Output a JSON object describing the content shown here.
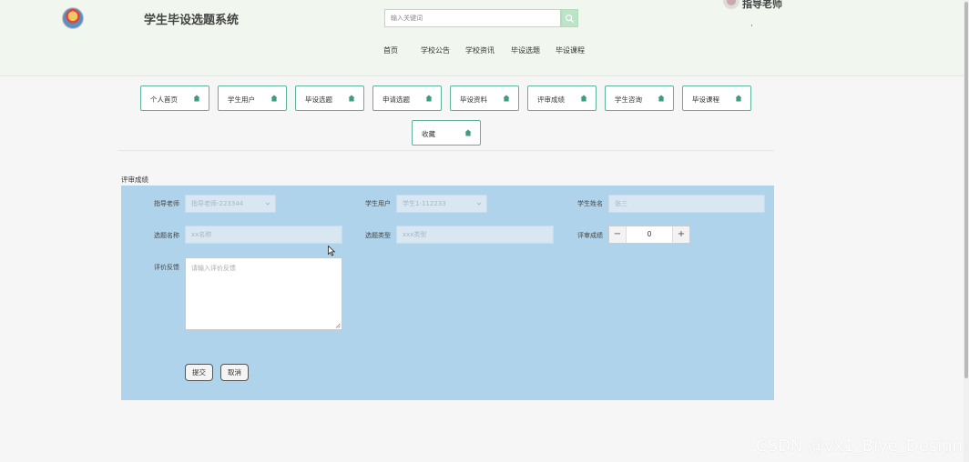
{
  "header": {
    "site_title": "学生毕设选题系统",
    "search_placeholder": "输入关键词",
    "user_name": "指导老师",
    "user_dot": "·",
    "nav": [
      "首页",
      "学校公告",
      "学校资讯",
      "毕设选题",
      "毕设课程"
    ]
  },
  "menu": [
    "个人首页",
    "学生用户",
    "毕设选题",
    "申请选题",
    "毕设资料",
    "评审成绩",
    "学生咨询",
    "毕设课程",
    "收藏"
  ],
  "form": {
    "section_title": "评审成绩",
    "teacher_label": "指导老师",
    "teacher_value": "指导老师-223344",
    "student_user_label": "学生用户",
    "student_user_value": "学生1-112233",
    "student_name_label": "学生姓名",
    "student_name_value": "张三",
    "topic_name_label": "选题名称",
    "topic_name_placeholder": "xx名称",
    "topic_type_label": "选题类型",
    "topic_type_placeholder": "xxx类型",
    "score_label": "评审成绩",
    "score_value": "0",
    "minus": "−",
    "plus": "+",
    "feedback_label": "评价反馈",
    "feedback_placeholder": "请输入评价反馈",
    "submit": "提交",
    "cancel": "取消"
  },
  "watermark": "CSDN @vx1_Biye_Design",
  "colors": {
    "header_bg": "#f1f6ee",
    "accent_green": "#5fb39a",
    "form_bg": "#aed3ea",
    "field_bg": "#d9e7f3"
  },
  "icons": {
    "search": "search-icon",
    "menu_item": "house-icon",
    "select": "chevron-down-icon"
  }
}
